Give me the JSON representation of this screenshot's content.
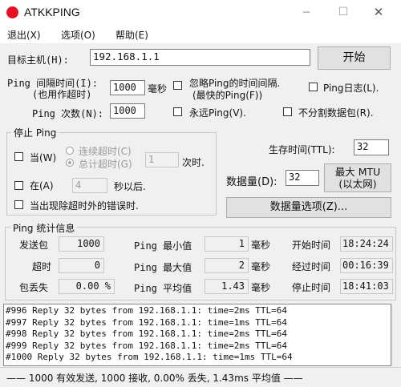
{
  "window": {
    "title": "ATKKPING",
    "accent": "#e81123"
  },
  "menu": {
    "exit": "退出(X)",
    "options": "选项(O)",
    "help": "帮助(E)"
  },
  "target": {
    "label": "目标主机(H):",
    "value": "192.168.1.1",
    "start_button": "开始"
  },
  "ping_interval": {
    "label_line1": "Ping 间隔时间(I):",
    "label_line2": "(也用作超时)",
    "value": "1000",
    "unit": "毫秒"
  },
  "ignore_fastest": {
    "label_line1": "忽略Ping的时间间隔.",
    "label_line2": "(最快的Ping(F))",
    "checked": false
  },
  "ping_log": {
    "label": "Ping日志(L).",
    "checked": false
  },
  "ping_count": {
    "label": "Ping 次数(N):",
    "value": "1000"
  },
  "forever": {
    "label": "永远Ping(V).",
    "checked": false
  },
  "no_fragment": {
    "label": "不分割数据包(R).",
    "checked": false
  },
  "stop_group": {
    "title": "停止 Ping",
    "when_label": "当(W)",
    "radio_consecutive": "连续超时(C)",
    "radio_total": "总计超时(G)",
    "timeout_value": "1",
    "times_label": "次时.",
    "at_label": "在(A)",
    "at_value": "4",
    "seconds_after": "秒以后.",
    "error_label": "当出现除超时外的错误时."
  },
  "ttl": {
    "label": "生存时间(TTL):",
    "value": "32"
  },
  "data_size": {
    "label": "数据量(D):",
    "value": "32",
    "mtu_line1": "最大 MTU",
    "mtu_line2": "(以太网)"
  },
  "data_options_button": "数据量选项(Z)...",
  "stats": {
    "title": "Ping  统计信息",
    "sent_label": "发送包",
    "sent": "1000",
    "timeout_label": "超时",
    "timeout": "0",
    "loss_label": "包丢失",
    "loss": "0.00 %",
    "min_label": "Ping 最小值",
    "min": "1",
    "min_unit": "毫秒",
    "max_label": "Ping 最大值",
    "max": "2",
    "max_unit": "毫秒",
    "avg_label": "Ping 平均值",
    "avg": "1.43",
    "avg_unit": "毫秒",
    "start_label": "开始时间",
    "start": "18:24:24",
    "elapsed_label": "经过时间",
    "elapsed": "00:16:39",
    "stop_label": "停止时间",
    "stop": "18:41:03"
  },
  "log": [
    "#996 Reply 32 bytes from 192.168.1.1: time=2ms TTL=64",
    "#997 Reply 32 bytes from 192.168.1.1: time=1ms TTL=64",
    "#998 Reply 32 bytes from 192.168.1.1: time=2ms TTL=64",
    "#999 Reply 32 bytes from 192.168.1.1: time=2ms TTL=64",
    "#1000 Reply 32 bytes from 192.168.1.1: time=1ms TTL=64"
  ],
  "status_bar": "—— 1000 有效发送, 1000 接收, 0.00% 丢失, 1.43ms 平均值 ——"
}
